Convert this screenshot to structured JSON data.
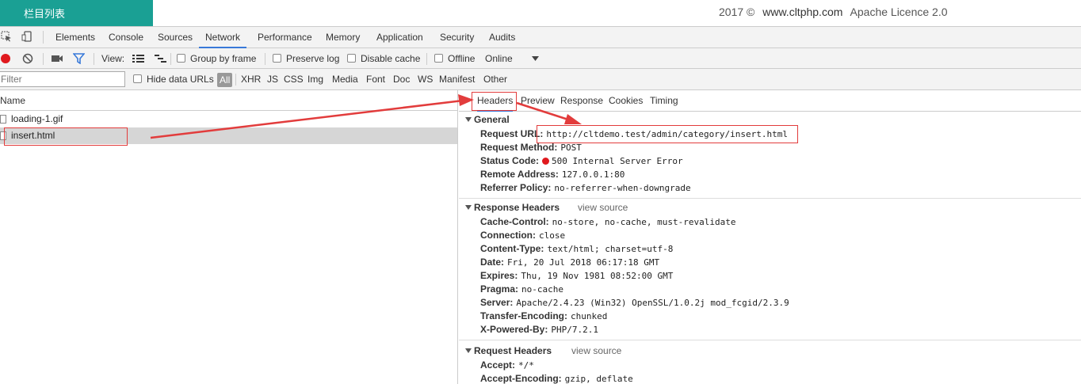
{
  "topbar": {
    "title": "栏目列表",
    "year": "2017 ©",
    "site": "www.cltphp.com",
    "licence": "Apache Licence 2.0",
    "accent": "#1aa094"
  },
  "devtools": {
    "tabs": [
      "Elements",
      "Console",
      "Sources",
      "Network",
      "Performance",
      "Memory",
      "Application",
      "Security",
      "Audits"
    ],
    "active_tab": "Network",
    "icons": [
      "inspect-icon",
      "device-toggle-icon"
    ]
  },
  "network_toolbar": {
    "view_label": "View:",
    "group_by_frame": "Group by frame",
    "preserve_log": "Preserve log",
    "disable_cache": "Disable cache",
    "offline": "Offline",
    "throttle": "Online",
    "record_color": "#e0191e"
  },
  "filter_bar": {
    "placeholder": "Filter",
    "hide_data_urls": "Hide data URLs",
    "types": [
      "All",
      "XHR",
      "JS",
      "CSS",
      "Img",
      "Media",
      "Font",
      "Doc",
      "WS",
      "Manifest",
      "Other"
    ],
    "active_type": "All"
  },
  "requests": {
    "column": "Name",
    "items": [
      {
        "name": "loading-1.gif"
      },
      {
        "name": "insert.html"
      }
    ],
    "selected": "insert.html"
  },
  "detail": {
    "tabs": [
      "Headers",
      "Preview",
      "Response",
      "Cookies",
      "Timing"
    ],
    "active_tab": "Headers",
    "general": {
      "title": "General",
      "rows": [
        {
          "k": "Request URL:",
          "v": "http://cltdemo.test/admin/category/insert.html"
        },
        {
          "k": "Request Method:",
          "v": "POST"
        },
        {
          "k": "Status Code:",
          "v": "500 Internal Server Error"
        },
        {
          "k": "Remote Address:",
          "v": "127.0.0.1:80"
        },
        {
          "k": "Referrer Policy:",
          "v": "no-referrer-when-downgrade"
        }
      ]
    },
    "response_headers": {
      "title": "Response Headers",
      "view_source": "view source",
      "rows": [
        {
          "k": "Cache-Control:",
          "v": "no-store, no-cache, must-revalidate"
        },
        {
          "k": "Connection:",
          "v": "close"
        },
        {
          "k": "Content-Type:",
          "v": "text/html; charset=utf-8"
        },
        {
          "k": "Date:",
          "v": "Fri, 20 Jul 2018 06:17:18 GMT"
        },
        {
          "k": "Expires:",
          "v": "Thu, 19 Nov 1981 08:52:00 GMT"
        },
        {
          "k": "Pragma:",
          "v": "no-cache"
        },
        {
          "k": "Server:",
          "v": "Apache/2.4.23 (Win32) OpenSSL/1.0.2j mod_fcgid/2.3.9"
        },
        {
          "k": "Transfer-Encoding:",
          "v": "chunked"
        },
        {
          "k": "X-Powered-By:",
          "v": "PHP/7.2.1"
        }
      ]
    },
    "request_headers": {
      "title": "Request Headers",
      "view_source": "view source",
      "rows": [
        {
          "k": "Accept:",
          "v": "*/*"
        },
        {
          "k": "Accept-Encoding:",
          "v": "gzip, deflate"
        }
      ]
    }
  }
}
